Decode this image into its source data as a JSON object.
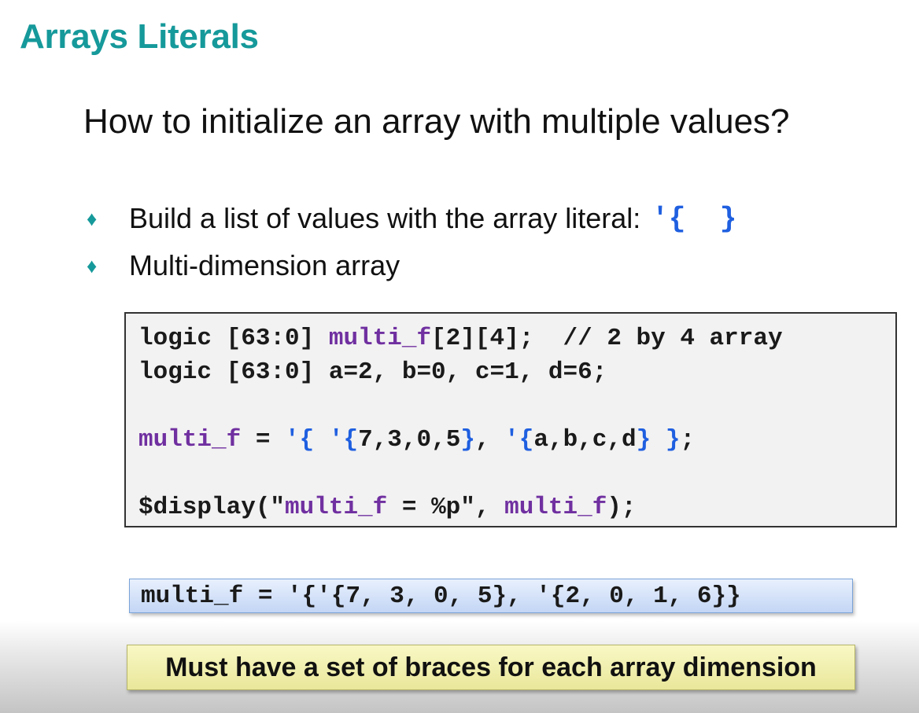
{
  "slide": {
    "title": "Arrays Literals",
    "question": "How to initialize an array with multiple values?"
  },
  "bullets": [
    {
      "text": "Build a list of values with the array literal:",
      "code": "'{  }"
    },
    {
      "text": "Multi-dimension array"
    }
  ],
  "bullet_icon": {
    "name": "diamond-bullet-icon",
    "glyph": "♦",
    "color": "#16999a"
  },
  "code": {
    "line1": {
      "pre": "logic [63:0] ",
      "var": "multi_f",
      "post": "[2][4];  // 2 by 4 array"
    },
    "line2": "logic [63:0] a=2, b=0, c=1, d=6;",
    "line3": {
      "var": "multi_f",
      "eq": " = ",
      "o1": "'{",
      "sp1": " ",
      "o2": "'{",
      "vals1": "7,3,0,5",
      "c2": "}",
      "comma": ", ",
      "o3": "'{",
      "vals2": "a,b,c,d",
      "c3": "}",
      "sp2": " ",
      "c1": "}",
      "end": ";"
    },
    "line4": {
      "pre": "$display(\"",
      "var1": "multi_f",
      "mid": " = %p\", ",
      "var2": "multi_f",
      "end": ");"
    }
  },
  "output": "multi_f = '{'{7, 3, 0, 5}, '{2, 0, 1, 6}}",
  "note": "Must have a set of braces for each array dimension",
  "colors": {
    "title": "#16999a",
    "keyword_var": "#7030a0",
    "brace": "#1f5fe0"
  }
}
